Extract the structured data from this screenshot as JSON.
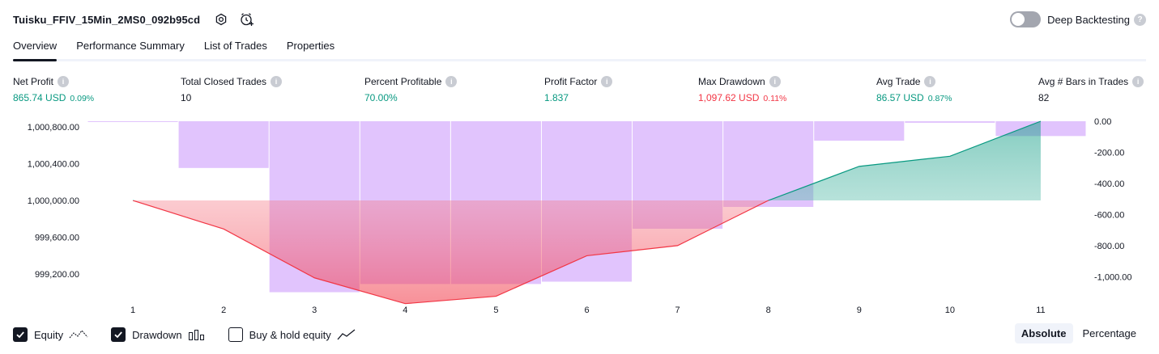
{
  "header": {
    "strategy_title": "Tuisku_FFIV_15Min_2MS0_092b95cd",
    "deep_backtesting_label": "Deep Backtesting",
    "deep_backtesting_enabled": false
  },
  "tabs": [
    {
      "label": "Overview",
      "active": true
    },
    {
      "label": "Performance Summary",
      "active": false
    },
    {
      "label": "List of Trades",
      "active": false
    },
    {
      "label": "Properties",
      "active": false
    }
  ],
  "stats": [
    {
      "label": "Net Profit",
      "value": "865.74 USD",
      "pct": "0.09%",
      "tone": "green"
    },
    {
      "label": "Total Closed Trades",
      "value": "10",
      "pct": "",
      "tone": "dark"
    },
    {
      "label": "Percent Profitable",
      "value": "70.00%",
      "pct": "",
      "tone": "green"
    },
    {
      "label": "Profit Factor",
      "value": "1.837",
      "pct": "",
      "tone": "green"
    },
    {
      "label": "Max Drawdown",
      "value": "1,097.62 USD",
      "pct": "0.11%",
      "tone": "red"
    },
    {
      "label": "Avg Trade",
      "value": "86.57 USD",
      "pct": "0.87%",
      "tone": "green"
    },
    {
      "label": "Avg # Bars in Trades",
      "value": "82",
      "pct": "",
      "tone": "dark"
    }
  ],
  "chart_data": {
    "type": "line",
    "x": [
      1,
      2,
      3,
      4,
      5,
      6,
      7,
      8,
      9,
      10,
      11
    ],
    "x_tick_labels": [
      "1",
      "2",
      "3",
      "4",
      "5",
      "6",
      "7",
      "8",
      "9",
      "10",
      "11"
    ],
    "y_left_ticks": [
      "1,000,800.00",
      "1,000,400.00",
      "1,000,000.00",
      "999,600.00",
      "999,200.00"
    ],
    "y_left_tick_values": [
      1000800,
      1000400,
      1000000,
      999600,
      999200
    ],
    "y_left_range": [
      999000,
      1000860
    ],
    "y_right_ticks": [
      "0.00",
      "-200.00",
      "-400.00",
      "-600.00",
      "-800.00",
      "-1,000.00"
    ],
    "y_right_tick_values": [
      0,
      -200,
      -400,
      -600,
      -800,
      -1000
    ],
    "y_right_range": [
      -1100,
      0
    ],
    "baseline": 1000000,
    "series": [
      {
        "name": "Equity",
        "kind": "line",
        "values": [
          1000000,
          999690,
          999160,
          998880,
          998960,
          999400,
          999510,
          1000000,
          1000370,
          1000480,
          1000860
        ]
      },
      {
        "name": "Drawdown",
        "kind": "bar",
        "values": [
          -5,
          -300,
          -1097.62,
          -1045,
          -1045,
          -1030,
          -690,
          -550,
          -125,
          -10,
          -95
        ]
      }
    ],
    "colors": {
      "equity_line_loss": "#f23645",
      "equity_line_gain": "#089981",
      "equity_fill_loss": "#f7a9b4",
      "equity_fill_gain": "#c6ebe2",
      "drawdown_bar": "#e1c4fd"
    },
    "grid": false,
    "legend": "bottom-left"
  },
  "legend": [
    {
      "label": "Equity",
      "checked": true,
      "icon": "equity-line-icon"
    },
    {
      "label": "Drawdown",
      "checked": true,
      "icon": "drawdown-bars-icon"
    },
    {
      "label": "Buy & hold equity",
      "checked": false,
      "icon": "buy-hold-line-icon"
    }
  ],
  "mode": {
    "absolute_label": "Absolute",
    "percentage_label": "Percentage",
    "selected": "absolute"
  }
}
